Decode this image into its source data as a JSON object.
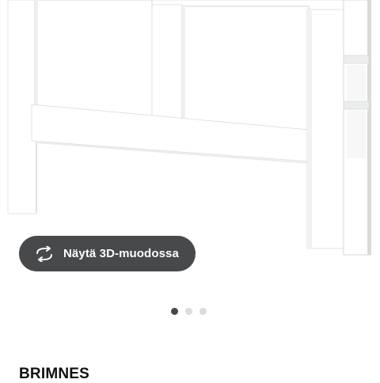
{
  "view_3d_button": {
    "label": "Näytä 3D-muodossa",
    "icon": "rotate-3d-icon"
  },
  "carousel": {
    "total": 3,
    "active_index": 0
  },
  "product": {
    "name": "BRIMNES"
  },
  "colors": {
    "furniture": "#ffffff",
    "furniture_shadow": "#d5d8d6",
    "button_bg": "#48494a",
    "dot_active": "#484848",
    "dot_inactive": "#dcdcdc"
  }
}
